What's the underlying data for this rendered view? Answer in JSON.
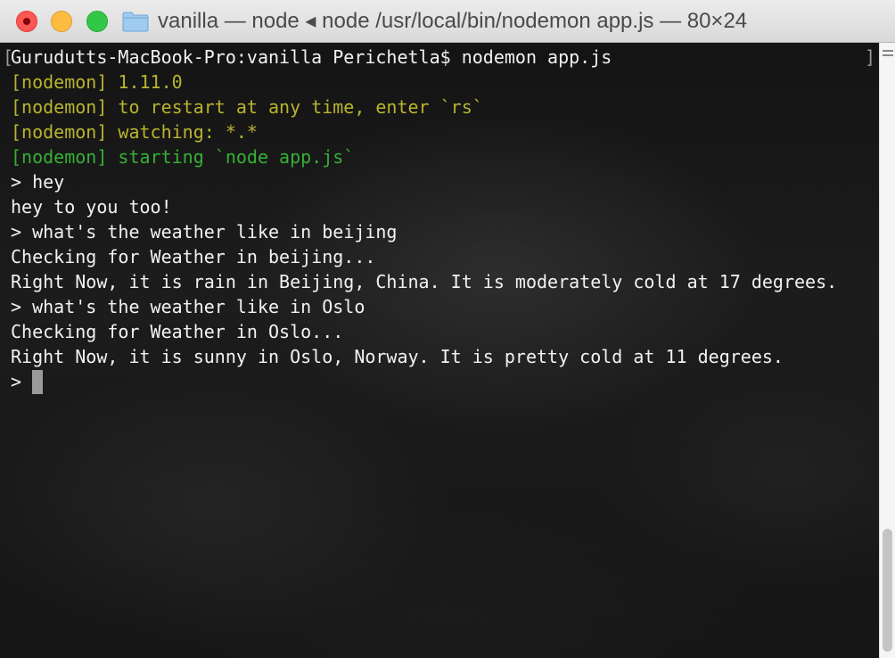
{
  "window": {
    "title": "vanilla — node ◂ node /usr/local/bin/nodemon app.js — 80×24"
  },
  "terminal": {
    "lines": [
      {
        "text": "Gurudutts-MacBook-Pro:vanilla Perichetla$ nodemon app.js",
        "color": "#f2f2f2"
      },
      {
        "text": "[nodemon] 1.11.0",
        "color": "#b9b42e"
      },
      {
        "text": "[nodemon] to restart at any time, enter `rs`",
        "color": "#b9b42e"
      },
      {
        "text": "[nodemon] watching: *.*",
        "color": "#b9b42e"
      },
      {
        "text": "[nodemon] starting `node app.js`",
        "color": "#36b035"
      },
      {
        "text": "> hey",
        "color": "#f2f2f2"
      },
      {
        "text": "hey to you too!",
        "color": "#f2f2f2"
      },
      {
        "text": "> what's the weather like in beijing",
        "color": "#f2f2f2"
      },
      {
        "text": "Checking for Weather in beijing...",
        "color": "#f2f2f2"
      },
      {
        "text": "Right Now, it is rain in Beijing, China. It is moderately cold at 17 degrees.",
        "color": "#f2f2f2"
      },
      {
        "text": "> what's the weather like in Oslo",
        "color": "#f2f2f2"
      },
      {
        "text": "Checking for Weather in Oslo...",
        "color": "#f2f2f2"
      },
      {
        "text": "Right Now, it is sunny in Oslo, Norway. It is pretty cold at 11 degrees.",
        "color": "#f2f2f2"
      },
      {
        "text": ">",
        "color": "#f2f2f2"
      }
    ],
    "bracket_left": "[",
    "bracket_right": "]"
  },
  "colors": {
    "close": "#fc5753",
    "minimize": "#fdbc40",
    "zoom": "#33c748",
    "folder": "#9fcbf0"
  },
  "icons": {
    "folder": "folder-icon",
    "split": "split-pane-icon"
  }
}
